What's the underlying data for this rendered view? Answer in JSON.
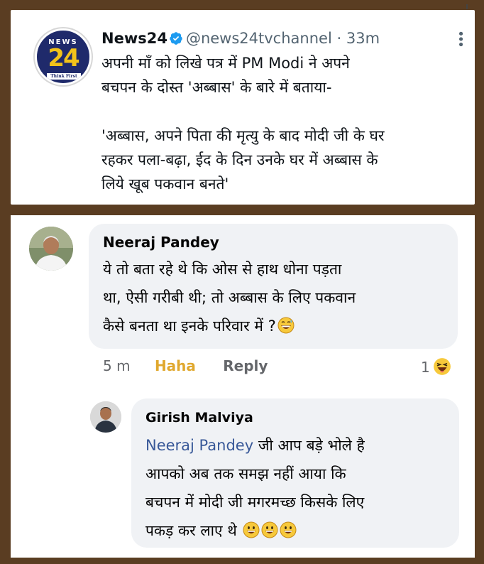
{
  "tweet": {
    "account_name": "News24",
    "handle": "@news24tvchannel",
    "separator": "·",
    "time": "33m",
    "logo": {
      "top_text": "NEWS",
      "number": "24",
      "tagline": "Think First"
    },
    "lines": [
      "अपनी माँ को लिखे पत्र में PM Modi ने अपने",
      "बचपन के दोस्त 'अब्बास' के बारे में बताया-",
      "",
      "'अब्बास, अपने पिता की मृत्यु के बाद मोदी जी के घर",
      "रहकर पला-बढ़ा, ईद के दिन उनके घर में अब्बास के",
      "लिये खूब पकवान बनते'"
    ],
    "verified_icon": "verified-badge-icon",
    "more_icon": "more-options-icon"
  },
  "comment": {
    "author": "Neeraj Pandey",
    "lines": [
      "ये तो बता रहे थे कि ओस से हाथ धोना पड़ता",
      "था, ऐसी गरीबी थी; तो अब्बास के लिए पकवान",
      "कैसे बनता था इनके परिवार में ?"
    ],
    "emoji": "grinning-sweat-emoji",
    "time": "5 m",
    "reaction_label": "Haha",
    "reply_label": "Reply",
    "reaction_count": "1",
    "reaction_icon": "laughing-emoji"
  },
  "reply": {
    "author": "Girish Malviya",
    "mention": "Neeraj Pandey",
    "first_line_rest": " जी आप बड़े भोले है",
    "lines": [
      "आपको अब तक समझ नहीं आया कि",
      "बचपन में मोदी जी मगरमच्छ किसके लिए",
      "पकड़ कर लाए थे"
    ],
    "emoji": "smiling-emoji"
  },
  "colors": {
    "frame": "#5a3d22",
    "twitter_text": "#0f1419",
    "twitter_muted": "#536471",
    "verified": "#1d9bf0",
    "fb_bubble": "#f0f2f5",
    "fb_mention": "#385898",
    "fb_haha": "#e0a82e",
    "fb_muted": "#65676b"
  }
}
